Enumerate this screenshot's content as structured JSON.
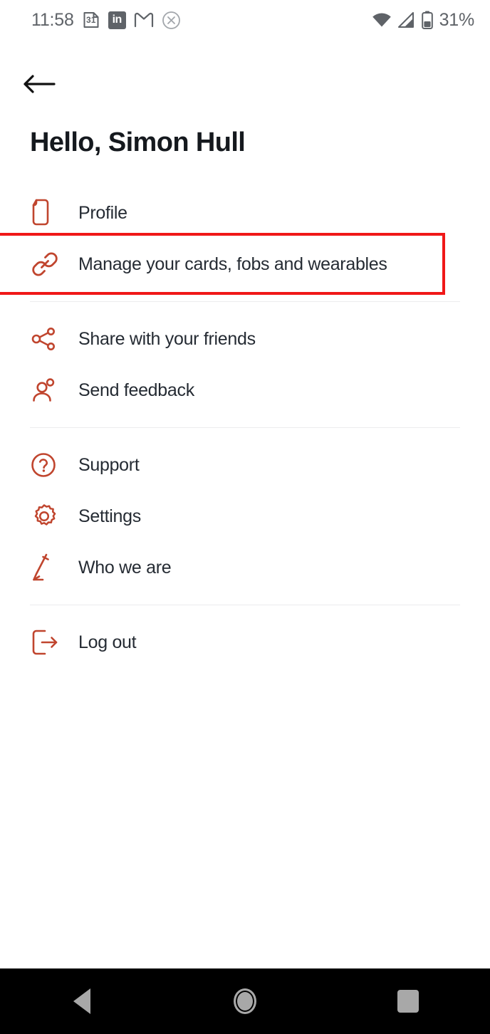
{
  "status_bar": {
    "time": "11:58",
    "calendar_day": "31",
    "linkedin_label": "in",
    "gmail_icon": "gmail-icon",
    "close_icon": "close-circle-icon",
    "wifi_icon": "wifi-icon",
    "signal_icon": "cellular-signal-icon",
    "battery_icon": "battery-icon",
    "battery_percent": "31%"
  },
  "header": {
    "back_icon": "back-arrow-icon",
    "greeting": "Hello, Simon Hull"
  },
  "menu": {
    "items": [
      {
        "id": "profile",
        "label": "Profile",
        "icon": "document-icon"
      },
      {
        "id": "manage",
        "label": "Manage your cards, fobs and wearables",
        "icon": "link-icon",
        "highlighted": true
      },
      {
        "id": "share",
        "label": "Share with your friends",
        "icon": "share-icon"
      },
      {
        "id": "feedback",
        "label": "Send feedback",
        "icon": "people-icon"
      },
      {
        "id": "support",
        "label": "Support",
        "icon": "question-circle-icon"
      },
      {
        "id": "settings",
        "label": "Settings",
        "icon": "gear-icon"
      },
      {
        "id": "about",
        "label": "Who we are",
        "icon": "pen-icon"
      },
      {
        "id": "logout",
        "label": "Log out",
        "icon": "logout-icon"
      }
    ]
  },
  "nav_bar": {
    "back_label": "back-triangle-icon",
    "home_label": "home-circle-icon",
    "recents_label": "recents-square-icon"
  },
  "colors": {
    "icon_accent": "#c0452e",
    "text_primary": "#252b33",
    "heading": "#15191e",
    "highlight_box": "#f01818",
    "divider": "#ececee",
    "status_gray": "#5f6368",
    "nav_gray": "#a8a8a8"
  }
}
